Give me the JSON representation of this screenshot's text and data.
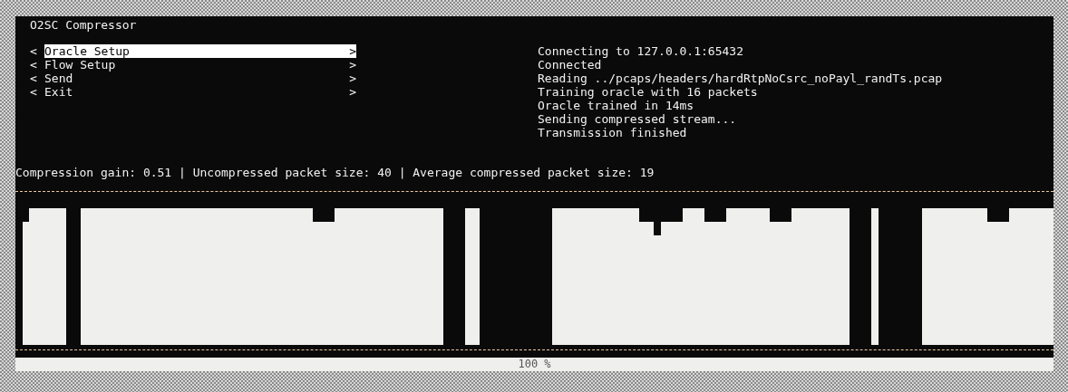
{
  "window": {
    "title": "O2SC Compressor"
  },
  "menu": [
    {
      "prefix": "<",
      "label": "Oracle Setup",
      "suffix": ">",
      "selected": true
    },
    {
      "prefix": "<",
      "label": "Flow Setup",
      "suffix": ">",
      "selected": false
    },
    {
      "prefix": "<",
      "label": "Send",
      "suffix": ">",
      "selected": false
    },
    {
      "prefix": "<",
      "label": "Exit",
      "suffix": ">",
      "selected": false
    }
  ],
  "log": [
    "Connecting to 127.0.0.1:65432",
    "Connected",
    "Reading ../pcaps/headers/hardRtpNoCsrc_noPayl_randTs.pcap",
    "Training oracle with 16 packets",
    "Oracle trained in 14ms",
    "Sending compressed stream...",
    "Transmission finished"
  ],
  "stats": "Compression gain: 0.51 | Uncompressed packet size: 40 | Average compressed packet size: 19",
  "progress": {
    "level": 1,
    "text": "100 %"
  }
}
